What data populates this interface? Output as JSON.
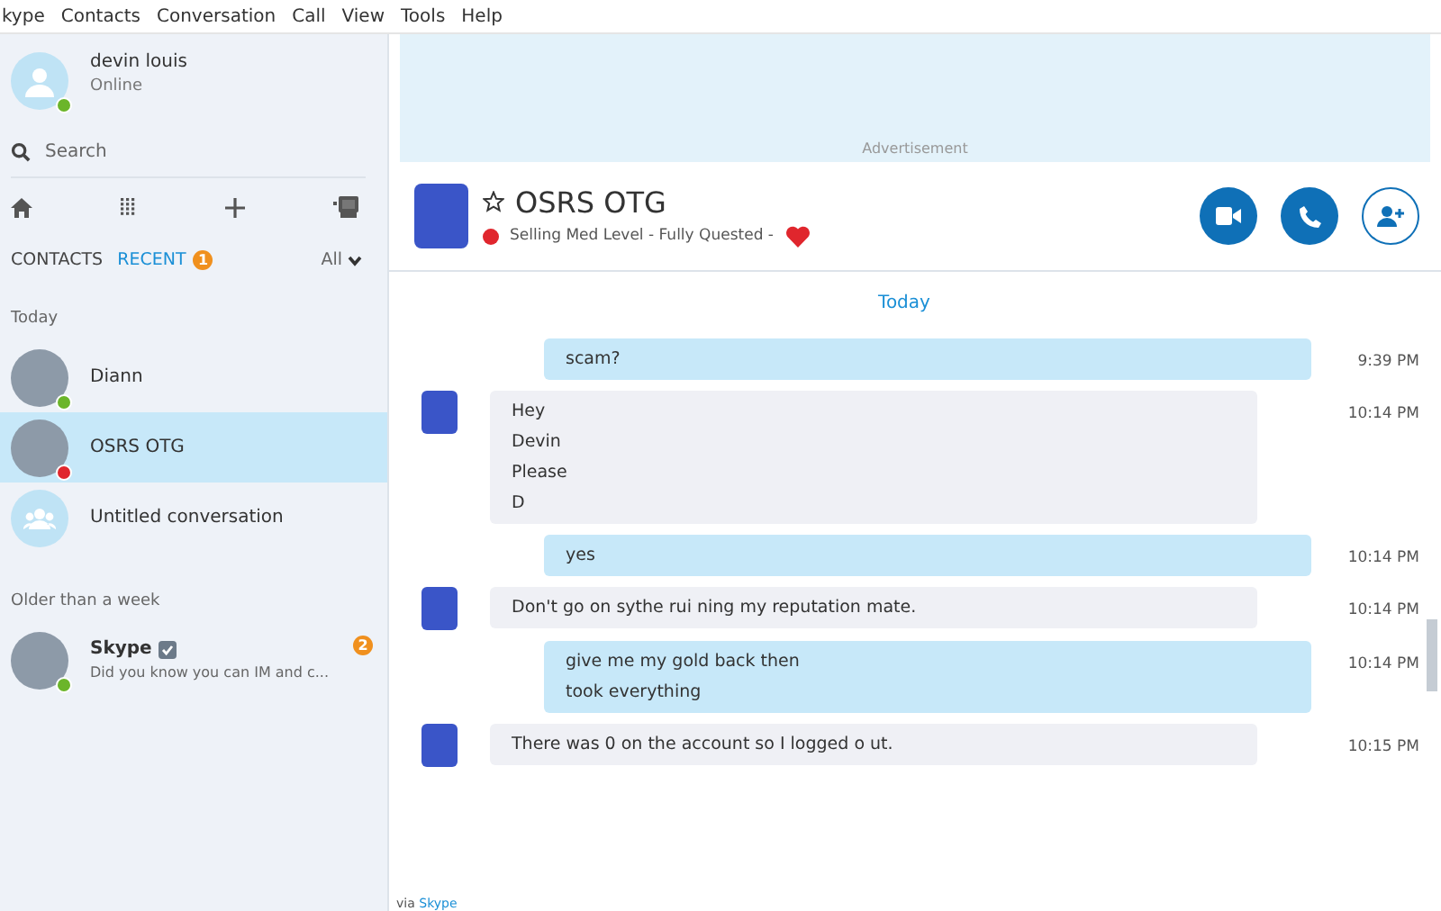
{
  "menu": [
    "kype",
    "Contacts",
    "Conversation",
    "Call",
    "View",
    "Tools",
    "Help"
  ],
  "profile": {
    "name": "devin louis",
    "status_text": "Online",
    "color": "#6bb52a"
  },
  "search": {
    "placeholder": "Search"
  },
  "tabs": [
    {
      "label": "CONTACTS",
      "selected": false
    },
    {
      "label": "RECENT",
      "selected": true,
      "badge": "1"
    }
  ],
  "filter": "All",
  "sections": [
    {
      "title": "Today",
      "items": [
        {
          "name": "Diann",
          "color": "#6bb52a",
          "selected": false,
          "group": false
        },
        {
          "name": "OSRS OTG",
          "color": "#e0262d",
          "selected": true,
          "group": false
        },
        {
          "name": "Untitled conversation",
          "selected": false,
          "group": true
        }
      ]
    },
    {
      "title": "Older than a week",
      "items": [
        {
          "name": "Skype",
          "color": "#6bb52a",
          "selected": false,
          "group": false,
          "verified": true,
          "preview": "Did you know you can IM and c...",
          "badge": "2"
        }
      ]
    }
  ],
  "advertisement": "Advertisement",
  "chat": {
    "title": "OSRS OTG",
    "color": "#e0262d",
    "mood": "Selling Med Level - Fully Quested -",
    "favorite": false
  },
  "day_label": "Today",
  "messages": [
    {
      "kind": "sent",
      "lines": [
        "scam?"
      ],
      "time": "9:39 PM"
    },
    {
      "kind": "received",
      "lines": [
        "Hey",
        "Devin",
        "Please",
        "D"
      ],
      "time": "10:14 PM"
    },
    {
      "kind": "sent",
      "lines": [
        "yes"
      ],
      "time": "10:14 PM"
    },
    {
      "kind": "received",
      "lines": [
        "Don't go on sythe rui ning my reputation mate."
      ],
      "time": "10:14 PM"
    },
    {
      "kind": "sent",
      "lines": [
        "give me my gold back then",
        "took everything"
      ],
      "time": "10:14 PM"
    },
    {
      "kind": "received",
      "lines": [
        "There was 0 on the account so I logged o ut."
      ],
      "time": "10:15 PM"
    }
  ],
  "footer": {
    "prefix": "via",
    "link": "Skype"
  }
}
